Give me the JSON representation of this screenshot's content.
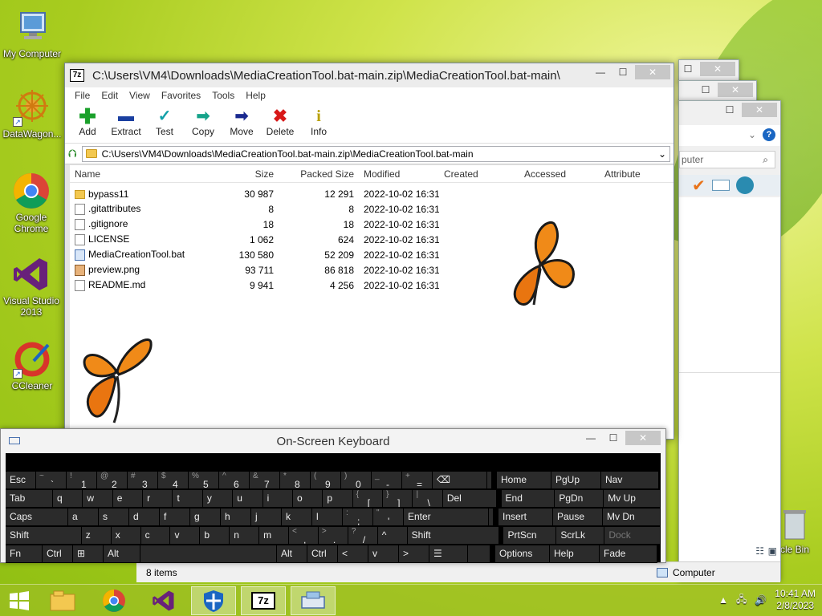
{
  "desktop": {
    "icons": [
      {
        "label": "My Computer"
      },
      {
        "label": "DataWagon..."
      },
      {
        "label": "Google Chrome"
      },
      {
        "label": "Visual Studio 2013"
      },
      {
        "label": "CCleaner"
      }
    ],
    "recycle_bin_label": "cle Bin"
  },
  "bg_explorer": {
    "search_placeholder": "puter",
    "status_items": "8 items",
    "status_location": "Computer"
  },
  "zip": {
    "title": "C:\\Users\\VM4\\Downloads\\MediaCreationTool.bat-main.zip\\MediaCreationTool.bat-main\\",
    "menu": [
      "File",
      "Edit",
      "View",
      "Favorites",
      "Tools",
      "Help"
    ],
    "toolbar": {
      "add": "Add",
      "extract": "Extract",
      "test": "Test",
      "copy": "Copy",
      "move": "Move",
      "delete": "Delete",
      "info": "Info"
    },
    "address": "C:\\Users\\VM4\\Downloads\\MediaCreationTool.bat-main.zip\\MediaCreationTool.bat-main",
    "columns": {
      "name": "Name",
      "size": "Size",
      "packed": "Packed Size",
      "modified": "Modified",
      "created": "Created",
      "accessed": "Accessed",
      "attributes": "Attribute"
    },
    "files": [
      {
        "name": "bypass11",
        "size": "30 987",
        "packed": "12 291",
        "modified": "2022-10-02 16:31",
        "type": "folder"
      },
      {
        "name": ".gitattributes",
        "size": "8",
        "packed": "8",
        "modified": "2022-10-02 16:31",
        "type": "file"
      },
      {
        "name": ".gitignore",
        "size": "18",
        "packed": "18",
        "modified": "2022-10-02 16:31",
        "type": "file"
      },
      {
        "name": "LICENSE",
        "size": "1 062",
        "packed": "624",
        "modified": "2022-10-02 16:31",
        "type": "file"
      },
      {
        "name": "MediaCreationTool.bat",
        "size": "130 580",
        "packed": "52 209",
        "modified": "2022-10-02 16:31",
        "type": "bat"
      },
      {
        "name": "preview.png",
        "size": "93 711",
        "packed": "86 818",
        "modified": "2022-10-02 16:31",
        "type": "png"
      },
      {
        "name": "README.md",
        "size": "9 941",
        "packed": "4 256",
        "modified": "2022-10-02 16:31",
        "type": "file"
      }
    ]
  },
  "osk": {
    "title": "On-Screen Keyboard",
    "rows": [
      [
        {
          "s": "",
          "m": "Esc"
        },
        {
          "s": "~",
          "m": "`"
        },
        {
          "s": "!",
          "m": "1"
        },
        {
          "s": "@",
          "m": "2"
        },
        {
          "s": "#",
          "m": "3"
        },
        {
          "s": "$",
          "m": "4"
        },
        {
          "s": "%",
          "m": "5"
        },
        {
          "s": "^",
          "m": "6"
        },
        {
          "s": "&",
          "m": "7"
        },
        {
          "s": "*",
          "m": "8"
        },
        {
          "s": "(",
          "m": "9"
        },
        {
          "s": ")",
          "m": "0"
        },
        {
          "s": "_",
          "m": "-"
        },
        {
          "s": "+",
          "m": "="
        },
        {
          "s": "",
          "m": "⌫"
        }
      ],
      [
        {
          "s": "",
          "m": "Tab"
        },
        {
          "s": "",
          "m": "q"
        },
        {
          "s": "",
          "m": "w"
        },
        {
          "s": "",
          "m": "e"
        },
        {
          "s": "",
          "m": "r"
        },
        {
          "s": "",
          "m": "t"
        },
        {
          "s": "",
          "m": "y"
        },
        {
          "s": "",
          "m": "u"
        },
        {
          "s": "",
          "m": "i"
        },
        {
          "s": "",
          "m": "o"
        },
        {
          "s": "",
          "m": "p"
        },
        {
          "s": "{",
          "m": "["
        },
        {
          "s": "}",
          "m": "]"
        },
        {
          "s": "|",
          "m": "\\"
        },
        {
          "s": "",
          "m": "Del"
        }
      ],
      [
        {
          "s": "",
          "m": "Caps"
        },
        {
          "s": "",
          "m": "a"
        },
        {
          "s": "",
          "m": "s"
        },
        {
          "s": "",
          "m": "d"
        },
        {
          "s": "",
          "m": "f"
        },
        {
          "s": "",
          "m": "g"
        },
        {
          "s": "",
          "m": "h"
        },
        {
          "s": "",
          "m": "j"
        },
        {
          "s": "",
          "m": "k"
        },
        {
          "s": "",
          "m": "l"
        },
        {
          "s": ":",
          "m": ";"
        },
        {
          "s": "\"",
          "m": "'"
        },
        {
          "s": "",
          "m": "Enter"
        }
      ],
      [
        {
          "s": "",
          "m": "Shift"
        },
        {
          "s": "",
          "m": "z"
        },
        {
          "s": "",
          "m": "x"
        },
        {
          "s": "",
          "m": "c"
        },
        {
          "s": "",
          "m": "v"
        },
        {
          "s": "",
          "m": "b"
        },
        {
          "s": "",
          "m": "n"
        },
        {
          "s": "",
          "m": "m"
        },
        {
          "s": "<",
          "m": ","
        },
        {
          "s": ">",
          "m": "."
        },
        {
          "s": "?",
          "m": "/"
        },
        {
          "s": "",
          "m": "^"
        },
        {
          "s": "",
          "m": "Shift"
        }
      ],
      [
        {
          "s": "",
          "m": "Fn"
        },
        {
          "s": "",
          "m": "Ctrl"
        },
        {
          "s": "",
          "m": "⊞"
        },
        {
          "s": "",
          "m": "Alt"
        },
        {
          "s": "",
          "m": ""
        },
        {
          "s": "",
          "m": "Alt"
        },
        {
          "s": "",
          "m": "Ctrl"
        },
        {
          "s": "",
          "m": "<"
        },
        {
          "s": "",
          "m": "v"
        },
        {
          "s": "",
          "m": ">"
        },
        {
          "s": "",
          "m": "☰"
        }
      ]
    ],
    "right_keys": [
      [
        "Home",
        "PgUp",
        "Nav"
      ],
      [
        "End",
        "PgDn",
        "Mv Up"
      ],
      [
        "Insert",
        "Pause",
        "Mv Dn"
      ],
      [
        "PrtScn",
        "ScrLk",
        "Dock"
      ],
      [
        "Options",
        "Help",
        "Fade"
      ]
    ]
  },
  "taskbar": {
    "time": "10:41 AM",
    "date": "2/8/2023"
  }
}
